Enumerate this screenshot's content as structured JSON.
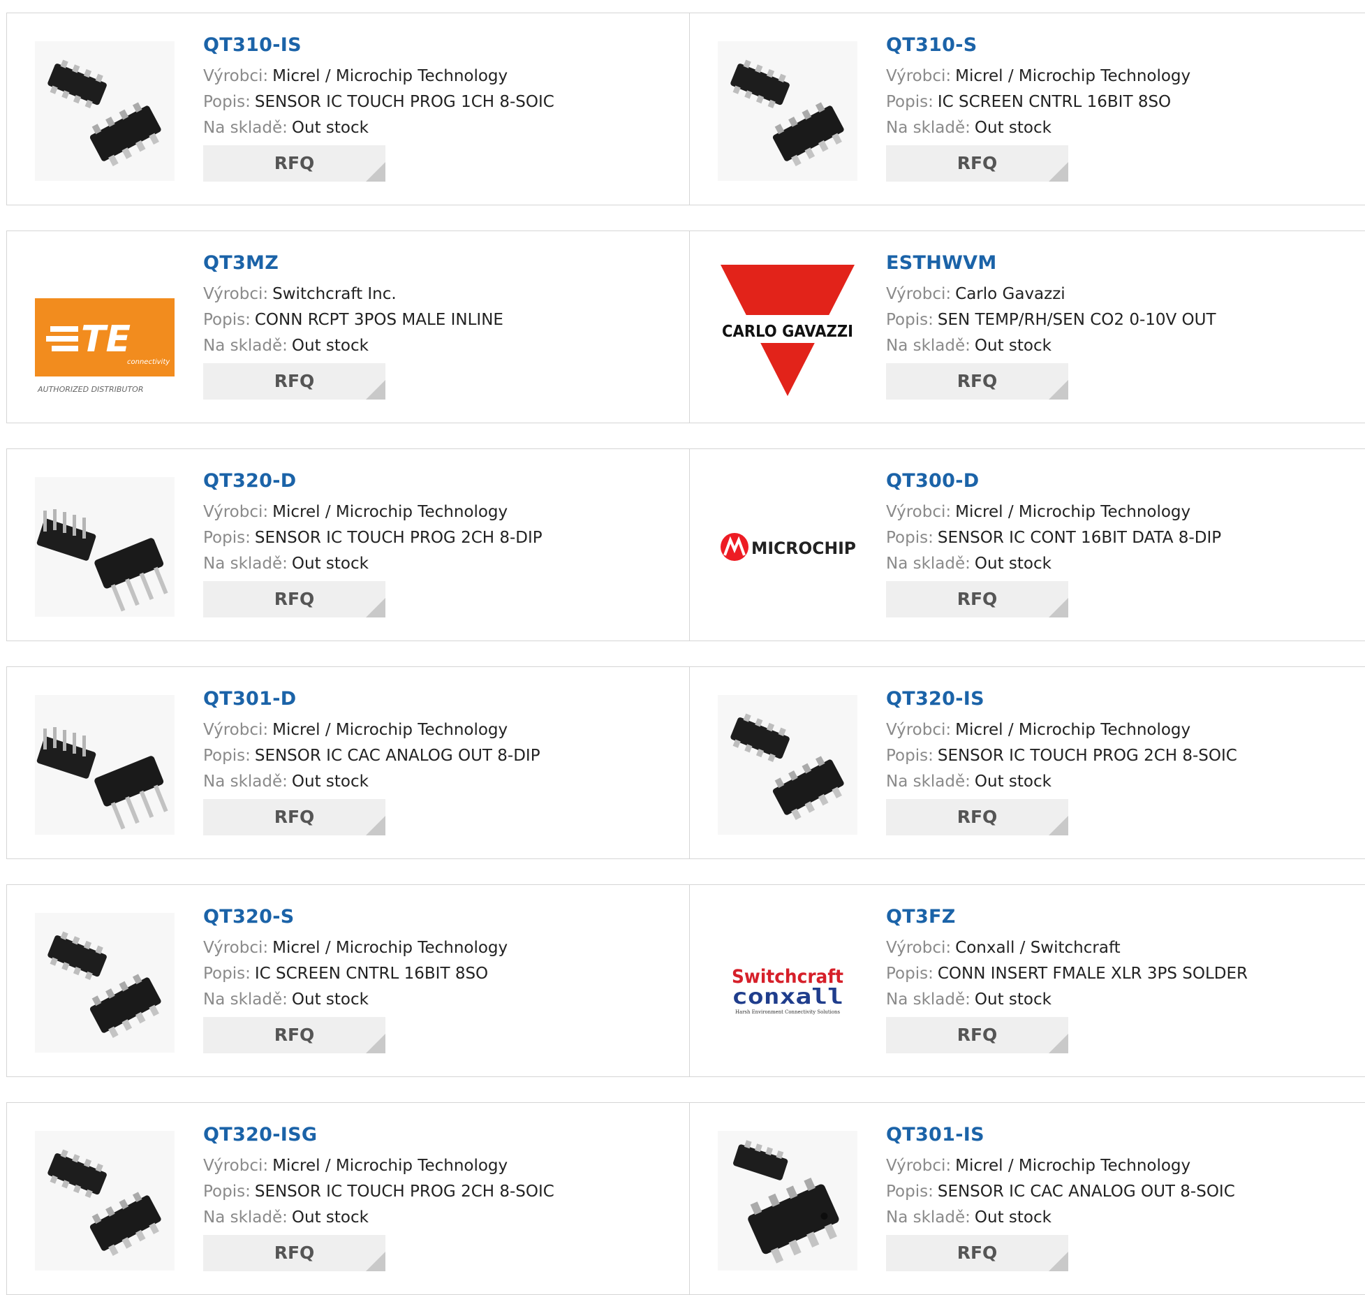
{
  "labels": {
    "manufacturer": "Výrobci:",
    "description": "Popis:",
    "stock": "Na skladě:",
    "rfq": "RFQ"
  },
  "colors": {
    "part_link": "#1b63a8",
    "label": "#8a8a8a",
    "te_orange": "#f28c1e",
    "gavazzi_red": "#e2231a",
    "microchip_red": "#ed1c24",
    "switchcraft_red": "#d6202a",
    "conxall_blue": "#1f3d8c"
  },
  "products": [
    {
      "part": "QT310-IS",
      "manufacturer": "Micrel / Microchip Technology",
      "description": "SENSOR IC TOUCH PROG 1CH 8-SOIC",
      "stock": "Out stock",
      "image": "soic-chip-icon"
    },
    {
      "part": "QT310-S",
      "manufacturer": "Micrel / Microchip Technology",
      "description": "IC SCREEN CNTRL 16BIT 8SO",
      "stock": "Out stock",
      "image": "soic-chip-icon"
    },
    {
      "part": "QT3MZ",
      "manufacturer": "Switchcraft Inc.",
      "description": "CONN RCPT 3POS MALE INLINE",
      "stock": "Out stock",
      "image": "te-connectivity-logo",
      "logo_text": {
        "brand": "TE",
        "sub": "connectivity",
        "caption": "AUTHORIZED DISTRIBUTOR"
      }
    },
    {
      "part": "ESTHWVM",
      "manufacturer": "Carlo Gavazzi",
      "description": "SEN TEMP/RH/SEN CO2 0-10V OUT",
      "stock": "Out stock",
      "image": "carlo-gavazzi-logo",
      "logo_text": {
        "brand": "CARLO GAVAZZI"
      }
    },
    {
      "part": "QT320-D",
      "manufacturer": "Micrel / Microchip Technology",
      "description": "SENSOR IC TOUCH PROG 2CH 8-DIP",
      "stock": "Out stock",
      "image": "dip-chip-icon"
    },
    {
      "part": "QT300-D",
      "manufacturer": "Micrel / Microchip Technology",
      "description": "SENSOR IC CONT 16BIT DATA 8-DIP",
      "stock": "Out stock",
      "image": "microchip-logo",
      "logo_text": {
        "brand": "MICROCHIP"
      }
    },
    {
      "part": "QT301-D",
      "manufacturer": "Micrel / Microchip Technology",
      "description": "SENSOR IC CAC ANALOG OUT 8-DIP",
      "stock": "Out stock",
      "image": "dip-chip-icon"
    },
    {
      "part": "QT320-IS",
      "manufacturer": "Micrel / Microchip Technology",
      "description": "SENSOR IC TOUCH PROG 2CH 8-SOIC",
      "stock": "Out stock",
      "image": "soic-chip-icon"
    },
    {
      "part": "QT320-S",
      "manufacturer": "Micrel / Microchip Technology",
      "description": "IC SCREEN CNTRL 16BIT 8SO",
      "stock": "Out stock",
      "image": "soic-chip-icon"
    },
    {
      "part": "QT3FZ",
      "manufacturer": "Conxall / Switchcraft",
      "description": "CONN INSERT FMALE XLR 3PS SOLDER",
      "stock": "Out stock",
      "image": "switchcraft-conxall-logo",
      "logo_text": {
        "brand": "Switchcraft",
        "sub": "conxall",
        "caption": "Harsh Environment Connectivity Solutions"
      }
    },
    {
      "part": "QT320-ISG",
      "manufacturer": "Micrel / Microchip Technology",
      "description": "SENSOR IC TOUCH PROG 2CH 8-SOIC",
      "stock": "Out stock",
      "image": "soic-chip-icon"
    },
    {
      "part": "QT301-IS",
      "manufacturer": "Micrel / Microchip Technology",
      "description": "SENSOR IC CAC ANALOG OUT 8-SOIC",
      "stock": "Out stock",
      "image": "soic-chip-large-icon"
    }
  ]
}
